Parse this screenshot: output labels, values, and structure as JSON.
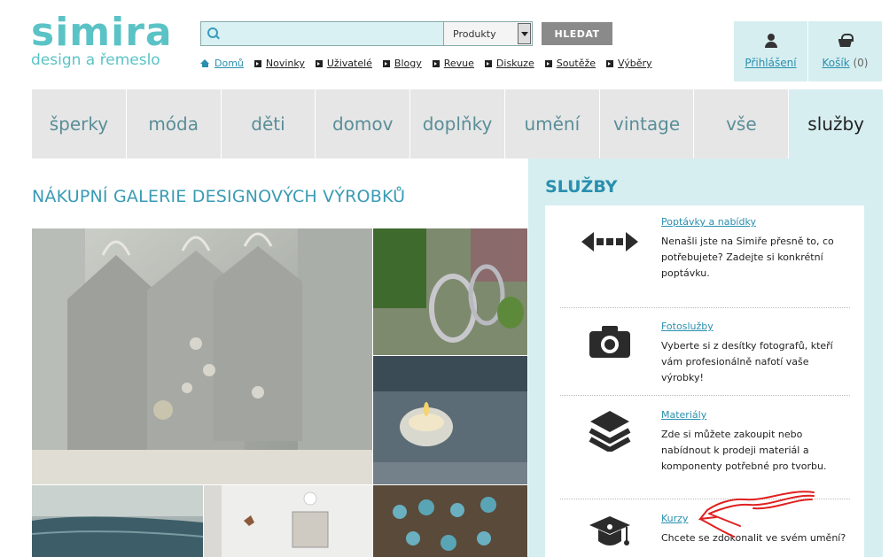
{
  "logo": {
    "main": "simira",
    "sub": "design a řemeslo"
  },
  "search": {
    "placeholder": "",
    "value": "",
    "category": "Produkty",
    "button": "HLEDAT"
  },
  "topnav": [
    "Domů",
    "Novinky",
    "Uživatelé",
    "Blogy",
    "Revue",
    "Diskuze",
    "Soutěže",
    "Výběry"
  ],
  "user": {
    "login": "Přihlášení",
    "cart": "Košík",
    "cart_count": "(0)"
  },
  "categories": [
    "šperky",
    "móda",
    "děti",
    "domov",
    "doplňky",
    "umění",
    "vintage",
    "vše",
    "služby"
  ],
  "active_category": "služby",
  "main": {
    "title": "NÁKUPNÍ GALERIE DESIGNOVÝCH VÝROBKŮ"
  },
  "sidebar": {
    "title": "SLUŽBY",
    "services": [
      {
        "link": "Poptávky a nabídky",
        "desc": "Nenašli jste na Simiře přesně to, co potřebujete? Zadejte si konkrétní poptávku.",
        "icon": "arrows-icon"
      },
      {
        "link": "Fotoslužby",
        "desc": "Vyberte si z desítky fotografů, kteří vám profesionálně nafotí vaše výrobky!",
        "icon": "camera-icon"
      },
      {
        "link": "Materiály",
        "desc": "Zde si můžete zakoupit nebo nabídnout k prodeji materiál a komponenty potřebné pro tvorbu.",
        "icon": "layers-icon"
      },
      {
        "link": "Kurzy",
        "desc": "Chcete se zdokonalit ve svém umění?",
        "icon": "graduation-cap-icon"
      }
    ]
  },
  "colors": {
    "accent": "#5bc3c6",
    "link": "#2a8fae",
    "panel": "#d6eef0",
    "annotation": "#e02020"
  }
}
